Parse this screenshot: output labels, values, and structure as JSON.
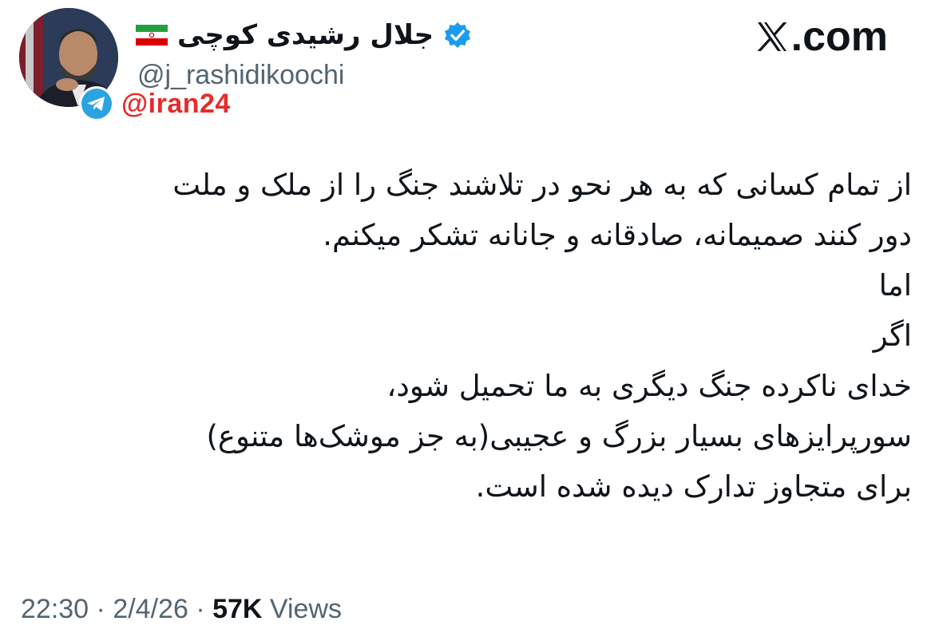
{
  "header": {
    "display_name": "جلال رشیدی کوچی",
    "handle": "@j_rashidikoochi",
    "verified": true,
    "flag_icon": "iran-flag-icon",
    "verified_icon": "verified-badge-icon",
    "verified_color": "#1d9bf0"
  },
  "watermark": {
    "telegram_icon": "telegram-icon",
    "telegram_color": "#2aa3e1",
    "channel": "@iran24",
    "channel_color": "#e52b2b"
  },
  "brand": {
    "icon": "x-logo-icon",
    "text": ".com"
  },
  "tweet": {
    "lines": [
      "از تمام کسانی که به هر نحو در تلاشند جنگ را از ملک و ملت",
      "دور کنند صمیمانه، صادقانه و جانانه تشکر میکنم.",
      "اما",
      "اگر",
      "خدای ناکرده جنگ دیگری به ما تحمیل شود،",
      "سورپرایزهای بسیار بزرگ و عجیبی(به جز موشک‌ها متنوع)",
      "برای متجاوز تدارک دیده شده است."
    ]
  },
  "meta": {
    "time": "22:30",
    "separator": "·",
    "date": "2/4/26",
    "views_count": "57K",
    "views_label": "Views"
  }
}
